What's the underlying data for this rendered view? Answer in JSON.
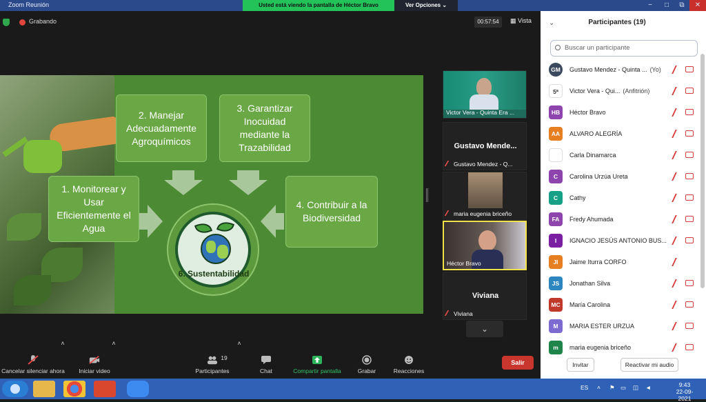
{
  "window": {
    "title": "Zoom Reunión",
    "share_notice": "Usted está viendo la pantalla de Héctor Bravo",
    "view_options": "Ver Opciones ⌄",
    "controls": [
      "−",
      "□",
      "⧉",
      "✕"
    ]
  },
  "meeting": {
    "recording_label": "Grabando",
    "timer": "00:57:54",
    "view_label": "Vista"
  },
  "slide": {
    "boxes": [
      "1. Monitorear y Usar Eficientemente el Agua",
      "2. Manejar Adecuadamente Agroquímicos",
      "3. Garantizar Inocuidad mediante la Trazabilidad",
      "4. Contribuir a la Biodiversidad"
    ],
    "center_label": "6. Sustentabilidad"
  },
  "video_tiles": [
    {
      "name": "Victor Vera - Quinta Era ..."
    },
    {
      "big": "Gustavo  Mende...",
      "name": "Gustavo Mendez - Q..."
    },
    {
      "name": "maria eugenia briceño"
    },
    {
      "name": "Héctor Bravo"
    },
    {
      "big": "Viviana",
      "name": "Viviana"
    }
  ],
  "toolbar": {
    "mute": "Cancelar silenciar ahora",
    "video": "Iniciar video",
    "participants": "Participantes",
    "participants_count": "19",
    "chat": "Chat",
    "share": "Compartir pantalla",
    "record": "Grabar",
    "reactions": "Reacciones",
    "leave": "Salir"
  },
  "panel": {
    "title": "Participantes (19)",
    "search_placeholder": "Buscar un participante",
    "participants": [
      {
        "initials": "GM",
        "color": "#3a4a5c",
        "name": "Gustavo Mendez - Quinta ...",
        "tag": "(Yo)"
      },
      {
        "initials": "5ª",
        "color": "#ffffff",
        "name": "Victor Vera - Qui...",
        "tag": "(Anfitrión)"
      },
      {
        "initials": "HB",
        "color": "#8e44ad",
        "name": "Héctor Bravo",
        "tag": ""
      },
      {
        "initials": "AA",
        "color": "#e67e22",
        "name": "ALVARO ALEGRÍA",
        "tag": ""
      },
      {
        "initials": "",
        "color": "#ffffff",
        "name": "Carla Dinamarca",
        "tag": ""
      },
      {
        "initials": "C",
        "color": "#8e44ad",
        "name": "Carolina Urzúa Ureta",
        "tag": ""
      },
      {
        "initials": "C",
        "color": "#16a085",
        "name": "Cathy",
        "tag": ""
      },
      {
        "initials": "FA",
        "color": "#8e44ad",
        "name": "Fredy Ahumada",
        "tag": ""
      },
      {
        "initials": "I",
        "color": "#7a1fa2",
        "name": "IGNACIO  JESÚS ANTONIO BUS...",
        "tag": ""
      },
      {
        "initials": "JI",
        "color": "#e67e22",
        "name": "Jaime Iturra CORFO",
        "tag": ""
      },
      {
        "initials": "JS",
        "color": "#2e86c1",
        "name": "Jonathan Silva",
        "tag": ""
      },
      {
        "initials": "MC",
        "color": "#c0392b",
        "name": "María Carolina",
        "tag": ""
      },
      {
        "initials": "M",
        "color": "#7d6bd1",
        "name": "MARIA ESTER URZUA",
        "tag": ""
      },
      {
        "initials": "m",
        "color": "#1e8449",
        "name": "maria eugenia briceño",
        "tag": ""
      }
    ],
    "invite": "Invitar",
    "unmute_me": "Reactivar mi audio"
  },
  "taskbar": {
    "lang": "ES",
    "time": "9:43",
    "date": "22-09-2021"
  }
}
